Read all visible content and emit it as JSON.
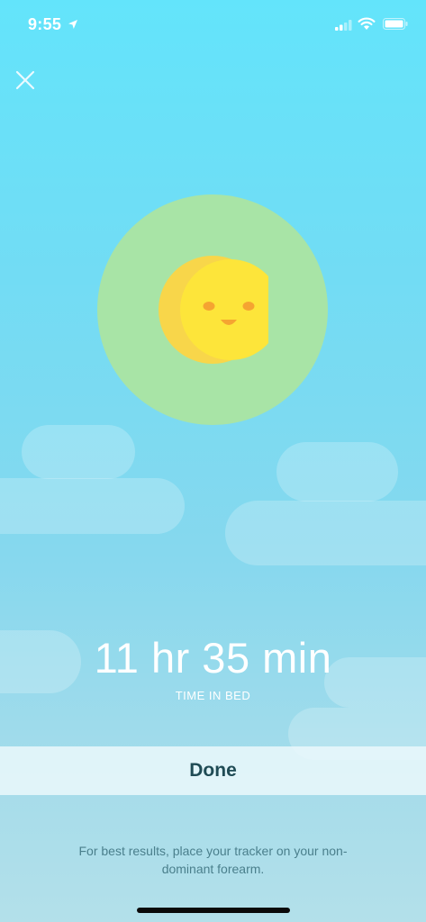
{
  "status_bar": {
    "time": "9:55",
    "icons": [
      "location-arrow-icon",
      "signal-bars-icon",
      "wifi-icon",
      "battery-icon"
    ]
  },
  "header": {
    "close_icon": "close-icon"
  },
  "sleep_summary": {
    "mood_icon": "happy-moon-icon",
    "duration": "11 hr 35 min",
    "label": "TIME IN BED"
  },
  "actions": {
    "done_label": "Done"
  },
  "footer": {
    "tip": "For best results, place your tracker on your non-dominant forearm."
  },
  "colors": {
    "sky_top": "#63e4fb",
    "sky_bottom": "#b3e0ea",
    "circle": "#a8e4a6",
    "moon": "#fde53a",
    "moon_shade": "#f8d64a",
    "done_text": "#1f4b55",
    "tip_text": "#4a7f8c"
  }
}
